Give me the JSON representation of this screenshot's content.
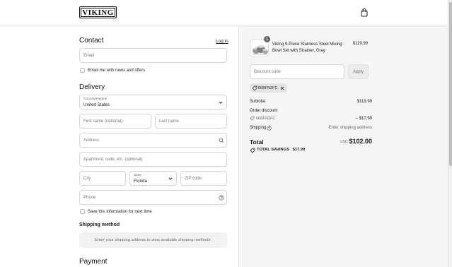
{
  "header": {
    "brand": "VIKING",
    "bag_icon": "shopping-bag-icon"
  },
  "contact": {
    "title": "Contact",
    "login_label": "Log in",
    "email_placeholder": "Email",
    "newsletter_label": "Email me with news and offers"
  },
  "delivery": {
    "title": "Delivery",
    "country_label": "Country/Region",
    "country_value": "United States",
    "first_name_placeholder": "First name (optional)",
    "last_name_placeholder": "Last name",
    "address_placeholder": "Address",
    "apartment_placeholder": "Apartment, suite, etc. (optional)",
    "city_placeholder": "City",
    "state_label": "State",
    "state_value": "Florida",
    "zip_placeholder": "ZIP code",
    "phone_placeholder": "Phone",
    "save_info_label": "Save this information for next time"
  },
  "shipping_method": {
    "title": "Shipping method",
    "message": "Enter your shipping address to view available shipping methods."
  },
  "payment": {
    "title": "Payment"
  },
  "summary": {
    "product": {
      "quantity": "1",
      "name": "Viking 9-Piece Stainless Steel Mixing Bowl Set with Strainer, Gray",
      "price": "$119.99"
    },
    "discount_placeholder": "Discount code",
    "apply_label": "Apply",
    "applied_code": "66BFN3FC",
    "subtotal_label": "Subtotal",
    "subtotal_value": "$119.99",
    "order_discount_label": "Order discount",
    "order_discount_code": "66BFN3FC",
    "order_discount_value": "– $17.99",
    "shipping_label": "Shipping",
    "shipping_value": "Enter shipping address",
    "total_label": "Total",
    "currency": "USD",
    "total_value": "$102.00",
    "savings_label": "TOTAL SAVINGS",
    "savings_value": "$17.99"
  },
  "colors": {
    "accent": "#1a1a1a",
    "summary_bg": "#f5f5f5",
    "border": "#d6d6d6"
  }
}
